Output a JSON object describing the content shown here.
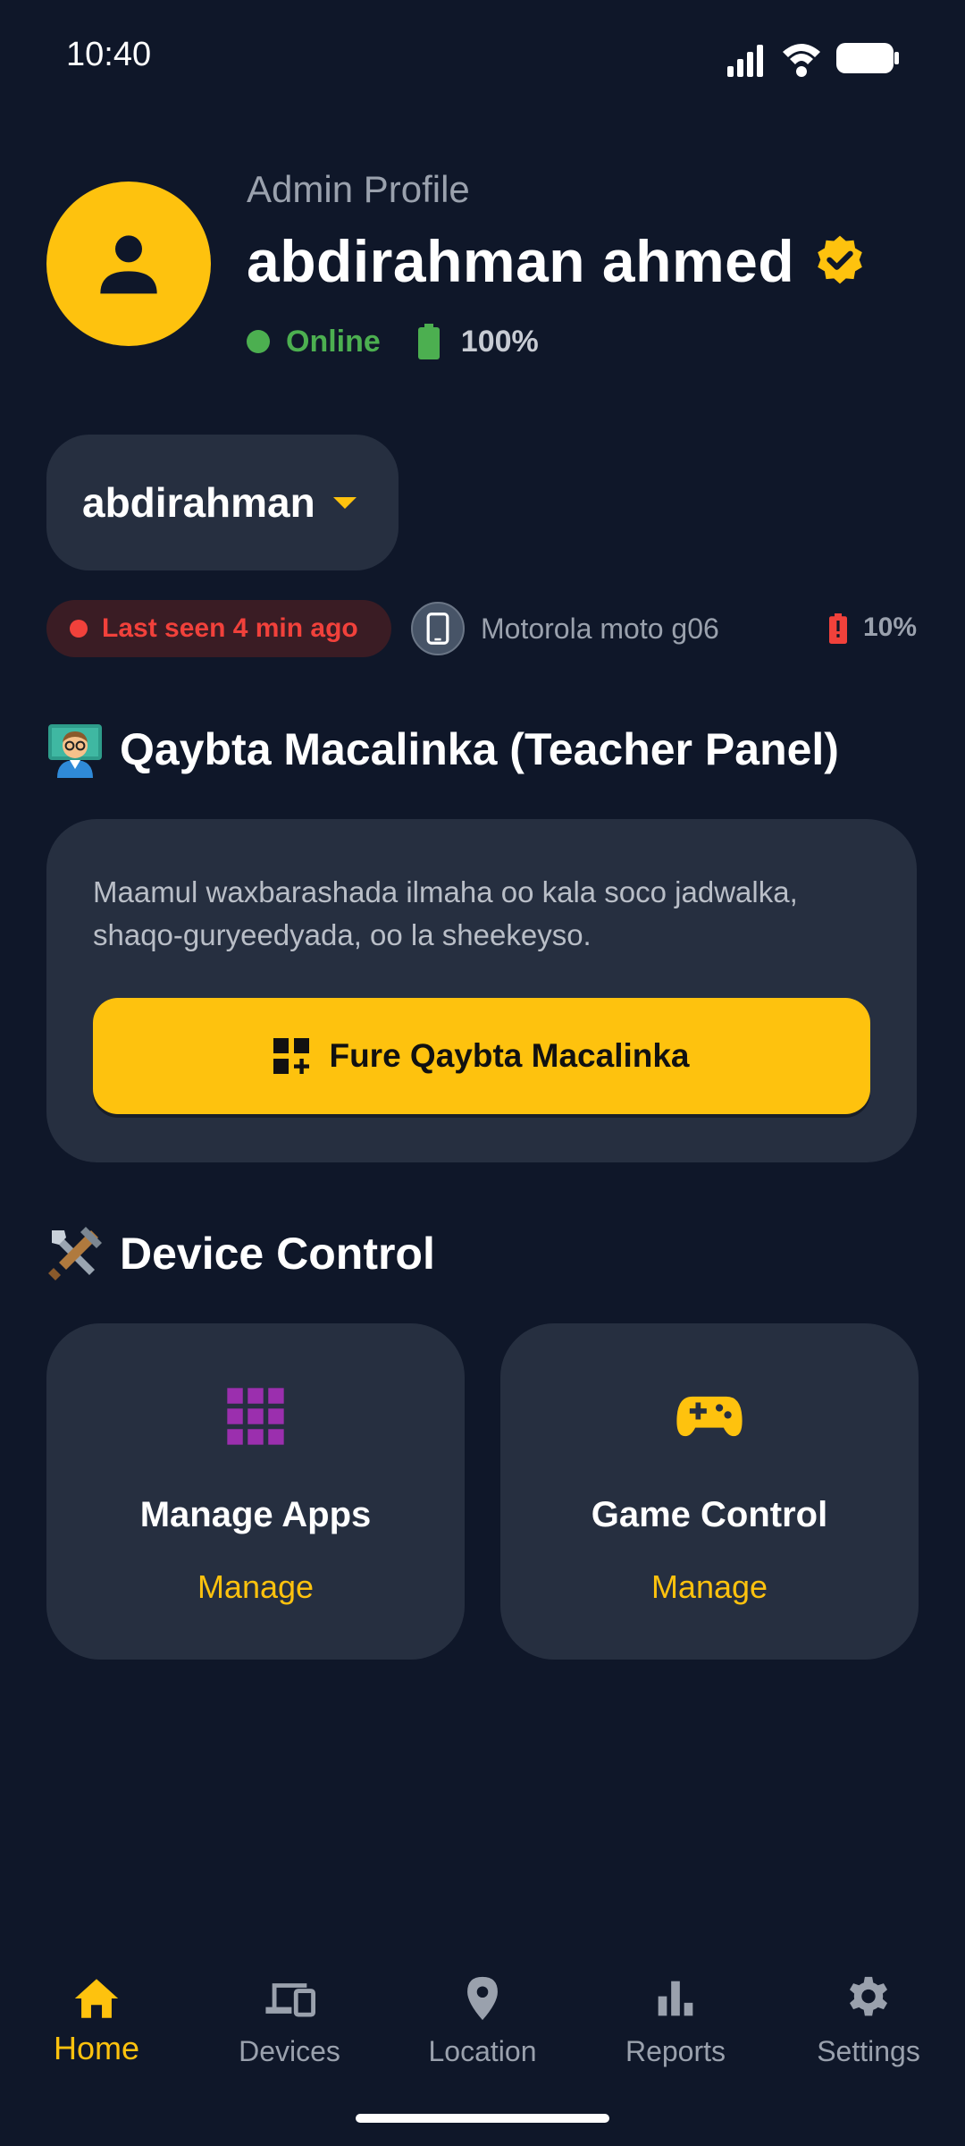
{
  "status_bar": {
    "time": "10:40",
    "icons": [
      "signal-icon",
      "wifi-icon",
      "battery-icon"
    ]
  },
  "profile": {
    "label": "Admin Profile",
    "name": "abdirahman ahmed",
    "status": "Online",
    "battery": "100%",
    "avatar_color": "#fec20e",
    "online_color": "#4caf50"
  },
  "device_selector": {
    "selected": "abdirahman"
  },
  "device_info": {
    "last_seen": "Last seen 4 min ago",
    "model": "Motorola moto g06",
    "battery": "10%"
  },
  "teacher_panel": {
    "heading": "Qaybta Macalinka (Teacher Panel)",
    "description": "Maamul waxbarashada ilmaha oo kala soco jadwalka, shaqo-guryeedyada, oo la sheekeyso.",
    "button_label": "Fure Qaybta Macalinka"
  },
  "device_control": {
    "heading": "Device Control",
    "cards": [
      {
        "title": "Manage Apps",
        "action": "Manage",
        "icon": "apps-grid-icon"
      },
      {
        "title": "Game Control",
        "action": "Manage",
        "icon": "gamepad-icon"
      }
    ]
  },
  "bottom_nav": {
    "items": [
      {
        "label": "Home",
        "icon": "home-icon",
        "active": true
      },
      {
        "label": "Devices",
        "icon": "devices-icon",
        "active": false
      },
      {
        "label": "Location",
        "icon": "location-pin-icon",
        "active": false
      },
      {
        "label": "Reports",
        "icon": "bar-chart-icon",
        "active": false
      },
      {
        "label": "Settings",
        "icon": "gear-icon",
        "active": false
      }
    ]
  },
  "colors": {
    "background": "#0f1729",
    "card": "#262f40",
    "accent": "#fec20e",
    "danger": "#f1413b",
    "muted": "#9aa1ad"
  }
}
